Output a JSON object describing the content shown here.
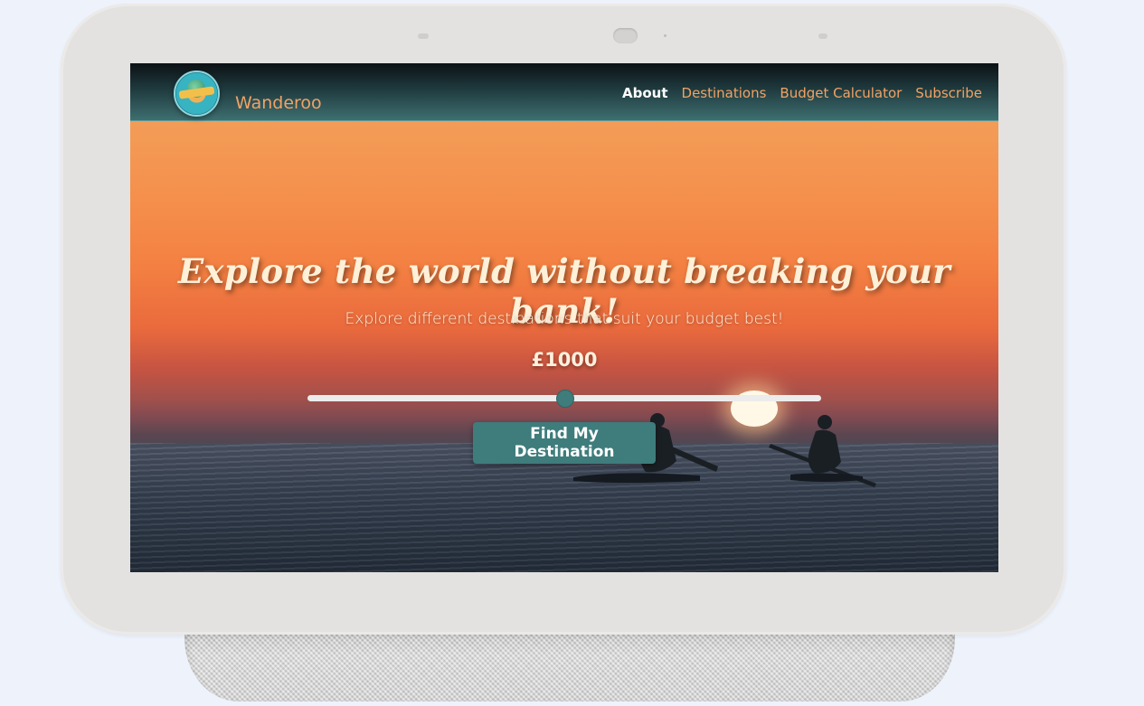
{
  "navbar": {
    "brand": "Wanderoo",
    "links": [
      {
        "label": "About",
        "active": true
      },
      {
        "label": "Destinations",
        "active": false
      },
      {
        "label": "Budget Calculator",
        "active": false
      },
      {
        "label": "Subscribe",
        "active": false
      }
    ]
  },
  "hero": {
    "title": "Explore the world without breaking your bank!",
    "subtitle": "Explore different destinations that suit your budget best!",
    "budget_display": "£1000",
    "slider": {
      "fraction": 0.5
    },
    "cta_label": "Find My Destination"
  },
  "colors": {
    "accent": "#3f7c7c",
    "nav_link": "#f2a265",
    "nav_active": "#ffffff",
    "hero_text": "#fff0dc"
  },
  "icons": {
    "logo": "wanderoo-logo-icon"
  }
}
